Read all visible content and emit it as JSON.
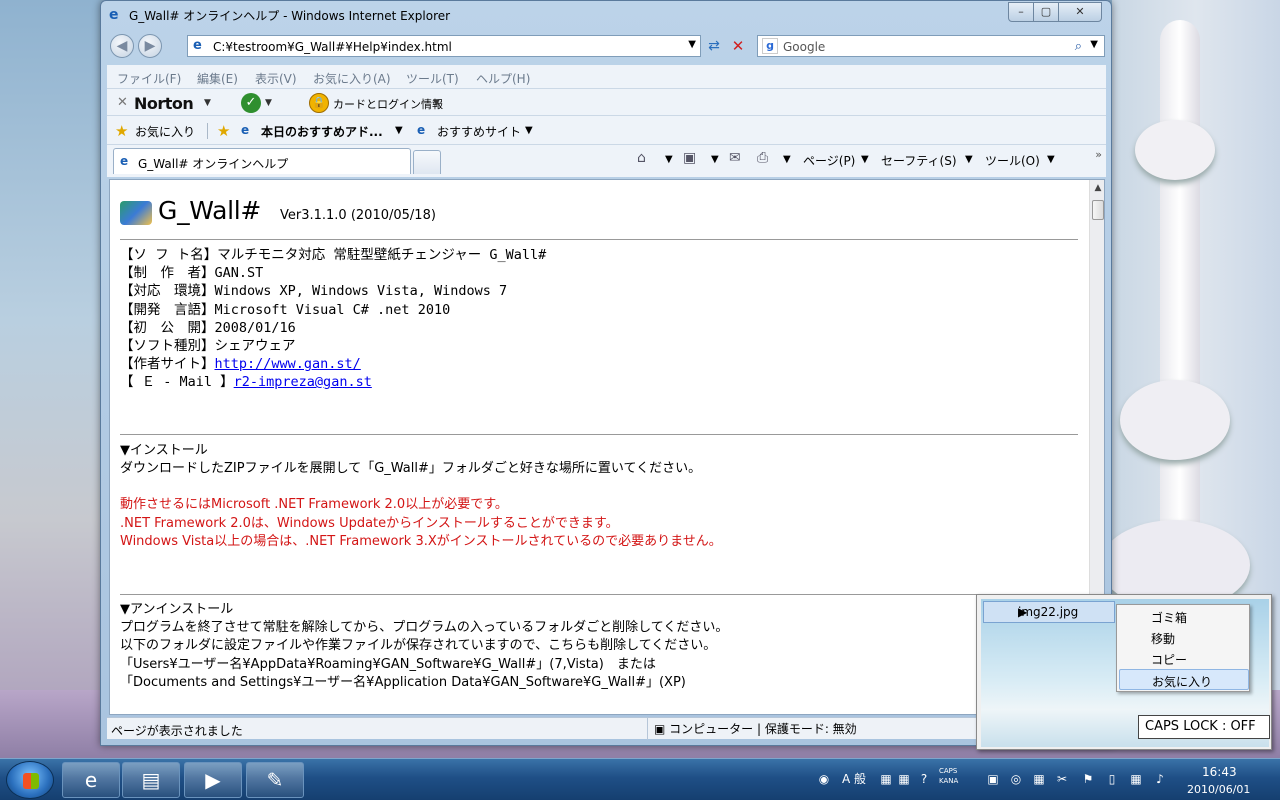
{
  "window": {
    "title": "G_Wall# オンラインヘルプ - Windows Internet Explorer",
    "controls": {
      "min": "–",
      "max": "▢",
      "close": "✕"
    }
  },
  "nav": {
    "address": "C:¥testroom¥G_Wall#¥Help¥index.html",
    "search_placeholder": "Google"
  },
  "menu": [
    "ファイル(F)",
    "編集(E)",
    "表示(V)",
    "お気に入り(A)",
    "ツール(T)",
    "ヘルプ(H)"
  ],
  "norton": {
    "logo": "Norton",
    "card_label": "カードとログイン情報"
  },
  "favorites": {
    "favorites_label": "お気に入り",
    "recommended_addon": "本日のおすすめアド...",
    "recommended_site": "おすすめサイト"
  },
  "tab": {
    "label": "G_Wall# オンラインヘルプ"
  },
  "commands": {
    "page": "ページ(P)",
    "safety": "セーフティ(S)",
    "tools": "ツール(O)"
  },
  "page": {
    "title": "G_Wall#",
    "version": "Ver3.1.1.0 (2010/05/18)",
    "info": [
      {
        "label": "【ソ フ ト名】",
        "value": "マルチモニタ対応 常駐型壁紙チェンジャー G_Wall#"
      },
      {
        "label": "【制　作　者】",
        "value": "GAN.ST"
      },
      {
        "label": "【対応　環境】",
        "value": "Windows XP, Windows Vista, Windows 7"
      },
      {
        "label": "【開発　言語】",
        "value": "Microsoft Visual C# .net 2010"
      },
      {
        "label": "【初　公　開】",
        "value": "2008/01/16"
      },
      {
        "label": "【ソフト種別】",
        "value": "シェアウェア"
      },
      {
        "label": "【作者サイト】",
        "value": "http://www.gan.st/",
        "link": true
      },
      {
        "label": "【 Ｅ - Mail 】",
        "value": "r2-impreza@gan.st",
        "link": true
      }
    ],
    "install": {
      "heading": "▼インストール",
      "text": "ダウンロードしたZIPファイルを展開して「G_Wall#」フォルダごと好きな場所に置いてください。",
      "notes": [
        "動作させるにはMicrosoft .NET Framework 2.0以上が必要です。",
        ".NET Framework 2.0は、Windows Updateからインストールすることができます。",
        "Windows Vista以上の場合は、.NET Framework 3.Xがインストールされているので必要ありません。"
      ]
    },
    "uninstall": {
      "heading": "▼アンインストール",
      "lines": [
        "プログラムを終了させて常駐を解除してから、プログラムの入っているフォルダごと削除してください。",
        "以下のフォルダに設定ファイルや作業ファイルが保存されていますので、こちらも削除してください。",
        "「Users¥ユーザー名¥AppData¥Roaming¥GAN_Software¥G_Wall#」(7,Vista)　または",
        "「Documents and Settings¥ユーザー名¥Application Data¥GAN_Software¥G_Wall#」(XP)"
      ]
    }
  },
  "status": {
    "text": "ページが表示されました",
    "zone": "コンピューター | 保護モード: 無効"
  },
  "popup": {
    "file": "img22.jpg",
    "menu": [
      "ゴミ箱",
      "移動",
      "コピー",
      "お気に入り"
    ],
    "highlighted": "お気に入り"
  },
  "caps_lock": "CAPS LOCK : OFF",
  "taskbar": {
    "ime": "A 般",
    "caps_label": "CAPS",
    "kana_label": "KANA",
    "time": "16:43",
    "date": "2010/06/01"
  }
}
